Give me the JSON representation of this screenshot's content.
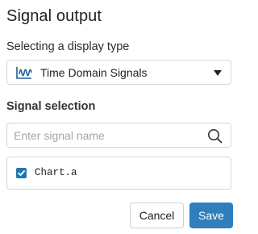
{
  "dialog": {
    "title": "Signal output"
  },
  "display_type": {
    "label": "Selecting a display type",
    "selected": "Time Domain Signals",
    "icon": "waveform-icon"
  },
  "signal_selection": {
    "label": "Signal selection",
    "search_placeholder": "Enter signal name",
    "search_value": "",
    "items": [
      {
        "label": "Chart.a",
        "checked": true
      }
    ]
  },
  "buttons": {
    "cancel": "Cancel",
    "save": "Save"
  },
  "colors": {
    "accent": "#2f7fbd",
    "checkbox": "#1f78b4",
    "icon": "#1f5f99"
  }
}
